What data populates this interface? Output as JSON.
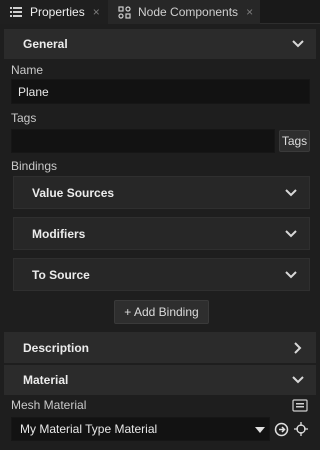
{
  "tabs": [
    {
      "label": "Properties",
      "icon": "list-icon",
      "close": "×"
    },
    {
      "label": "Node Components",
      "icon": "node-components-icon",
      "close": "×"
    }
  ],
  "sections": {
    "general": "General",
    "description": "Description",
    "material": "Material"
  },
  "fields": {
    "name_label": "Name",
    "name_value": "Plane",
    "tags_label": "Tags",
    "tags_value": "",
    "tags_button": "Tags",
    "bindings_label": "Bindings",
    "mesh_material_label": "Mesh Material",
    "mesh_material_value": "My Material Type Material"
  },
  "bindings": {
    "value_sources": "Value Sources",
    "modifiers": "Modifiers",
    "to_source": "To Source",
    "add_binding": "+ Add Binding"
  },
  "colors": {
    "background": "#1e1e1e",
    "section": "#2b2b2b",
    "input": "#121212",
    "text": "#d8d8d8"
  }
}
